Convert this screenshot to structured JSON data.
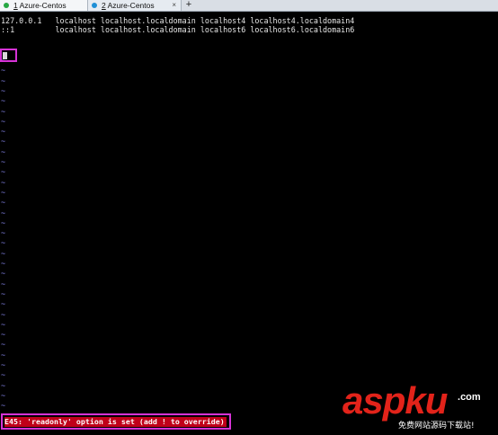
{
  "tabs": [
    {
      "number": "1",
      "label": "Azure-Centos",
      "color": "#27a844",
      "active": true
    },
    {
      "number": "2",
      "label": "Azure-Centos",
      "color": "#1e8fd6",
      "active": false
    }
  ],
  "tab_close_glyph": "×",
  "add_tab_glyph": "+",
  "terminal": {
    "lines": [
      "127.0.0.1   localhost localhost.localdomain localhost4 localhost4.localdomain4",
      "::1         localhost localhost.localdomain localhost6 localhost6.localdomain6"
    ],
    "empty_line_marker": "~",
    "status_message": "E45: 'readonly' option is set (add ! to override)"
  },
  "watermark": {
    "logo": "aspku",
    "tld": "com",
    "tagline": "免费网站源码下载站!"
  },
  "colors": {
    "background": "#000000",
    "text": "#e6e6e6",
    "tilde": "#7a7ad8",
    "error_bg": "#c0001a",
    "highlight_box": "#d633d6",
    "watermark_red": "#e2231a"
  }
}
